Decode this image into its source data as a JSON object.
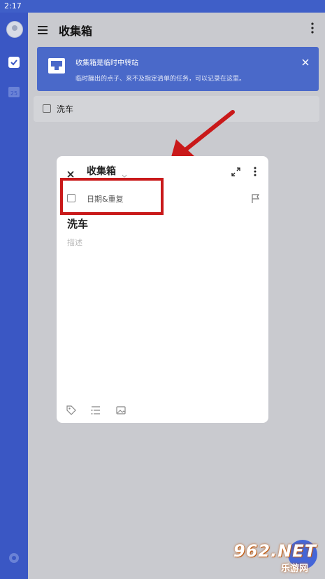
{
  "status_bar": {
    "time": "2:17"
  },
  "header": {
    "title": "收集箱"
  },
  "banner": {
    "title": "收集箱是临时中转站",
    "description": "临时蹦出的点子、来不及指定清单的任务，可以记录在这里。"
  },
  "list": {
    "tasks": [
      {
        "title": "洗车"
      }
    ]
  },
  "calendar": {
    "day": "25"
  },
  "modal": {
    "list_name": "收集箱",
    "date_repeat_label": "日期&重复",
    "task_title": "洗车",
    "description_placeholder": "描述"
  },
  "watermark": {
    "main": "962.NET",
    "sub": "乐游网"
  },
  "colors": {
    "accent": "#3a57c4",
    "highlight": "#c9191a",
    "banner": "#4a69c9"
  }
}
